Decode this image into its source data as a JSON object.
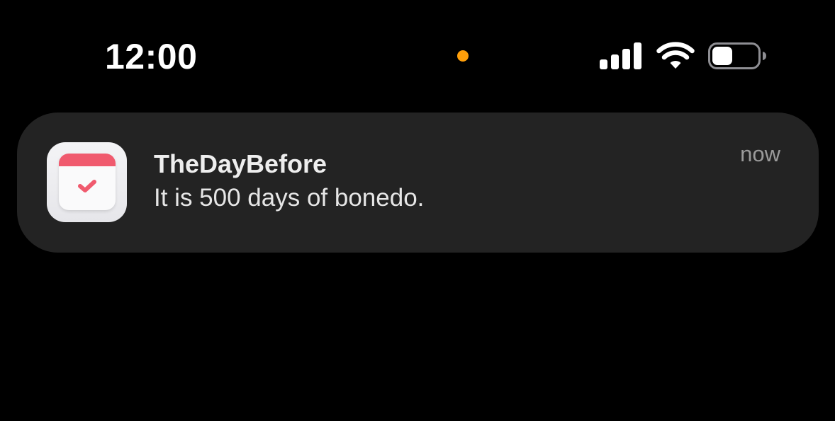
{
  "status_bar": {
    "time": "12:00",
    "privacy_indicator_color": "#ff9f0a",
    "signal_icon": "cellular-signal-icon",
    "wifi_icon": "wifi-icon",
    "battery_icon": "battery-icon",
    "battery_level": 0.45
  },
  "notification": {
    "app_name": "TheDayBefore",
    "message": "It is 500 days of bonedo.",
    "time": "now",
    "app_icon": "calendar-check-icon",
    "accent_color": "#f05a6e",
    "background_color": "#232323"
  }
}
